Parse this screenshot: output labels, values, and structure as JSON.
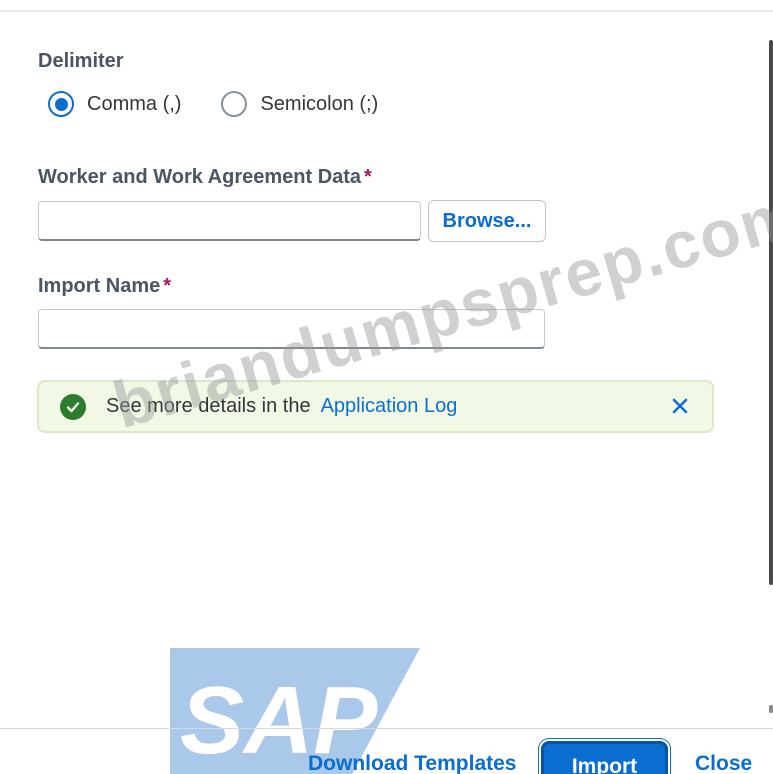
{
  "delimiter": {
    "label": "Delimiter",
    "options": [
      {
        "label": "Comma (,)",
        "selected": true
      },
      {
        "label": "Semicolon (;)",
        "selected": false
      }
    ]
  },
  "worker_data": {
    "label": "Worker and Work Agreement Data",
    "required_mark": "*",
    "value": "",
    "browse_label": "Browse..."
  },
  "import_name": {
    "label": "Import Name",
    "required_mark": "*",
    "value": ""
  },
  "message": {
    "text": "See more details in the",
    "link": "Application Log",
    "type": "success",
    "icon": "check-circle-icon",
    "close_icon": "close-icon"
  },
  "watermark": "briandumpsprep.com",
  "logo": "SAP",
  "footer": {
    "download_label": "Download Templates",
    "import_label": "Import",
    "close_label": "Close"
  },
  "colors": {
    "accent": "#0a6ed1",
    "required": "#a5175f",
    "success": "#2b7d2b",
    "success_bg": "#f1f9e6"
  }
}
